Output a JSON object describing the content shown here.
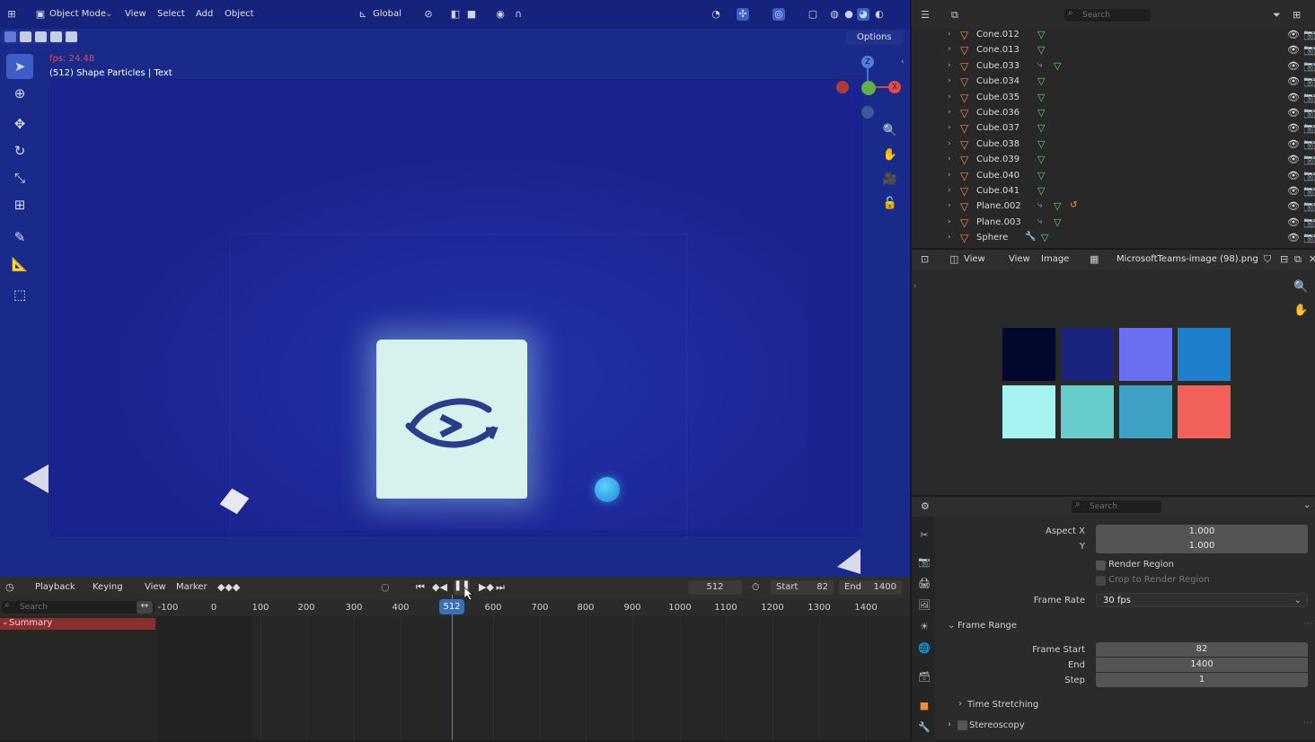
{
  "viewport": {
    "mode": "Object Mode",
    "menu": [
      "View",
      "Select",
      "Add",
      "Object"
    ],
    "transform_orientation": "Global",
    "options_label": "Options",
    "fps": "fps: 24.48",
    "info": "(512) Shape Particles | Text",
    "gizmo": {
      "z": "Z",
      "x": "X"
    }
  },
  "timeline": {
    "menu": [
      "Playback",
      "Keying",
      "View",
      "Marker"
    ],
    "current_frame": "512",
    "start_label": "Start",
    "start_value": "82",
    "end_label": "End",
    "end_value": "1400",
    "search_placeholder": "Search",
    "summary_label": "Summary",
    "ruler": [
      "-100",
      "0",
      "100",
      "200",
      "300",
      "400",
      "600",
      "700",
      "800",
      "900",
      "1000",
      "1100",
      "1200",
      "1300",
      "1400"
    ],
    "playhead": "512"
  },
  "outliner": {
    "search_placeholder": "Search",
    "items": [
      {
        "name": "Cone.012",
        "extra": ""
      },
      {
        "name": "Cone.013",
        "extra": ""
      },
      {
        "name": "Cube.033",
        "extra": "mod"
      },
      {
        "name": "Cube.034",
        "extra": ""
      },
      {
        "name": "Cube.035",
        "extra": ""
      },
      {
        "name": "Cube.036",
        "extra": ""
      },
      {
        "name": "Cube.037",
        "extra": ""
      },
      {
        "name": "Cube.038",
        "extra": ""
      },
      {
        "name": "Cube.039",
        "extra": ""
      },
      {
        "name": "Cube.040",
        "extra": ""
      },
      {
        "name": "Cube.041",
        "extra": ""
      },
      {
        "name": "Plane.002",
        "extra": "mod-curve"
      },
      {
        "name": "Plane.003",
        "extra": "mod"
      },
      {
        "name": "Sphere",
        "extra": "wrench"
      }
    ]
  },
  "image_editor": {
    "menu": [
      "View",
      "View",
      "Image"
    ],
    "image_name": "MicrosoftTeams-image (98).png",
    "swatches": [
      "#03082e",
      "#1a237d",
      "#6b6ff2",
      "#1f7fcf",
      "#a6f3f1",
      "#66cdcc",
      "#3fa1c5",
      "#f2615a"
    ]
  },
  "properties": {
    "search_placeholder": "Search",
    "aspect_x_label": "Aspect X",
    "aspect_x": "1.000",
    "aspect_y_label": "Y",
    "aspect_y": "1.000",
    "render_region": "Render Region",
    "crop_region": "Crop to Render Region",
    "frame_rate_label": "Frame Rate",
    "frame_rate": "30 fps",
    "frame_range_label": "Frame Range",
    "frame_start_label": "Frame Start",
    "frame_start": "82",
    "end_label": "End",
    "end": "1400",
    "step_label": "Step",
    "step": "1",
    "time_stretching": "Time Stretching",
    "stereoscopy": "Stereoscopy"
  }
}
